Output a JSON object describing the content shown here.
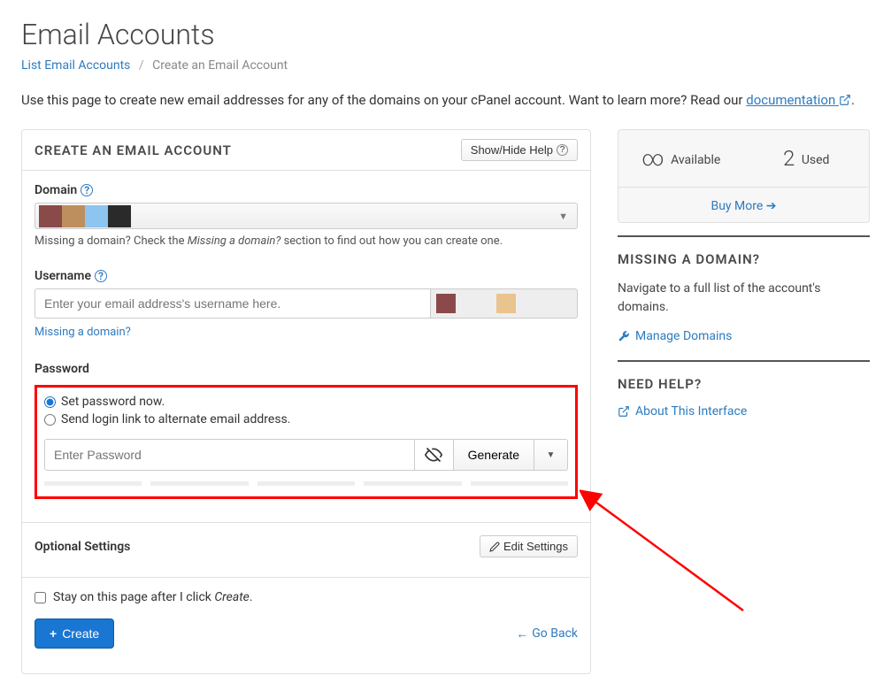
{
  "page_title": "Email Accounts",
  "breadcrumb": {
    "list": "List Email Accounts",
    "current": "Create an Email Account"
  },
  "intro": {
    "text": "Use this page to create new email addresses for any of the domains on your cPanel account. Want to learn more? Read our ",
    "doclink": "documentation"
  },
  "panel": {
    "title": "CREATE AN EMAIL ACCOUNT",
    "showhide": "Show/Hide Help",
    "domain_label": "Domain",
    "domain_hint_pre": "Missing a domain? Check the ",
    "domain_hint_em": "Missing a domain?",
    "domain_hint_post": " section to find out how you can create one.",
    "username_label": "Username",
    "username_placeholder": "Enter your email address's username here.",
    "missing_link": "Missing a domain?",
    "password_label": "Password",
    "radio_now": "Set password now.",
    "radio_link": "Send login link to alternate email address.",
    "pw_placeholder": "Enter Password",
    "generate": "Generate",
    "optional": "Optional Settings",
    "edit_settings": "Edit Settings",
    "stay_pre": "Stay on this page after I click ",
    "stay_em": "Create",
    "create": "Create",
    "goback": "Go Back"
  },
  "side": {
    "available_label": "Available",
    "used_value": "2",
    "used_label": "Used",
    "buy_more": "Buy More",
    "missing_h": "MISSING A DOMAIN?",
    "missing_text": "Navigate to a full list of the account's domains.",
    "manage_domains": "Manage Domains",
    "help_h": "NEED HELP?",
    "about": "About This Interface"
  }
}
